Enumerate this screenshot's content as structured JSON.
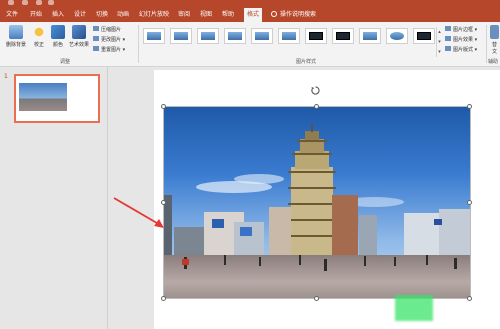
{
  "tabs": [
    "文件",
    "开始",
    "插入",
    "设计",
    "切换",
    "动画",
    "幻灯片放映",
    "审阅",
    "视图",
    "帮助",
    "格式"
  ],
  "active_tab": "格式",
  "tell_me": "操作说明搜索",
  "ribbon": {
    "remove_bg": "删除背景",
    "corrections": "校正",
    "color": "颜色",
    "artistic": "艺术效果",
    "compress": "压缩图片",
    "change": "更改图片",
    "reset": "重置图片",
    "group_adjust": "调整",
    "group_styles": "图片样式",
    "border": "图片边框",
    "effects": "图片效果",
    "layout": "图片版式",
    "group_access": "辅助",
    "access_btn_1": "替",
    "access_btn_2": "文",
    "gallery_more": "▾"
  },
  "thumbs": {
    "slide_number": "1"
  },
  "colors": {
    "accent": "#b7472a",
    "selection": "#e8704f",
    "arrow": "#e53935",
    "highlight": "#3ce36a"
  }
}
